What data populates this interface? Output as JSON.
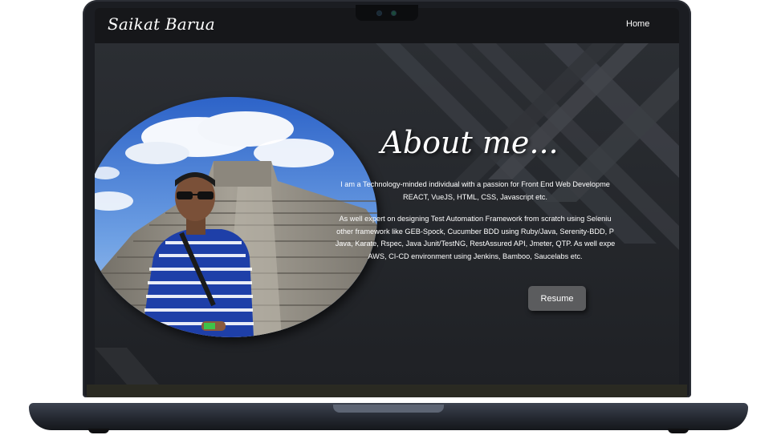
{
  "header": {
    "brand": "Saikat Barua",
    "nav": {
      "home": "Home"
    }
  },
  "about": {
    "title": "About me...",
    "paragraph1_lines": [
      "I am a Technology-minded individual with a passion for Front End Web Developme",
      "REACT, VueJS, HTML, CSS, Javascript etc."
    ],
    "paragraph2_lines": [
      "As well expert on designing Test Automation Framework from scratch using Seleniu",
      "other framework like GEB-Spock, Cucumber BDD using Ruby/Java, Serenity-BDD, P",
      "Java, Karate, Rspec, Java Junit/TestNG, RestAssured API, Jmeter, QTP. As well expe",
      "AWS, CI-CD environment using Jenkins, Bamboo, Saucelabs etc."
    ],
    "resume_label": "Resume"
  },
  "colors": {
    "screen_bg": "#25282d",
    "header_bg": "#16171a",
    "button_bg": "#5b5c5e",
    "text": "#ffffff"
  }
}
